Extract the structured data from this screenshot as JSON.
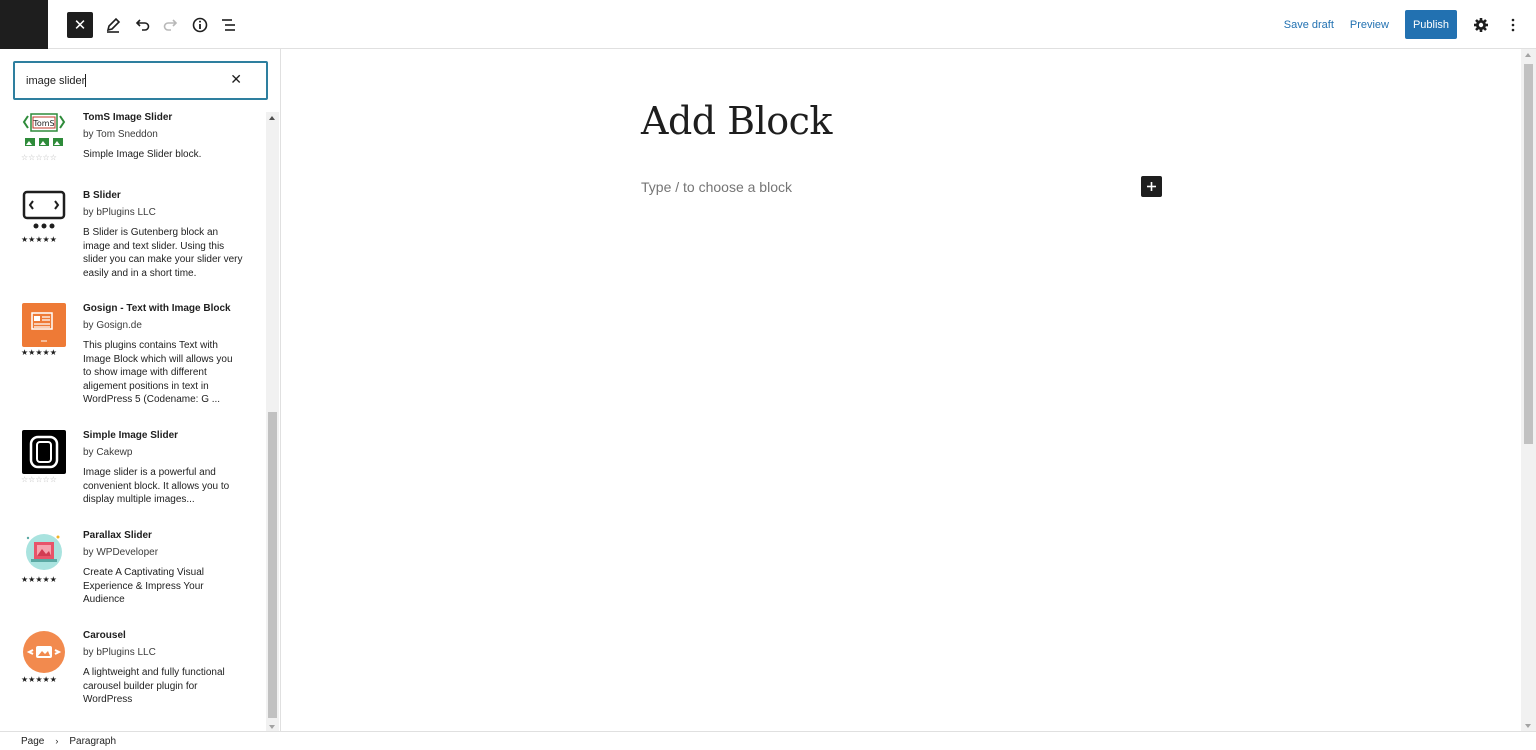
{
  "toolbar": {
    "close_label": "✕",
    "save_draft": "Save draft",
    "preview": "Preview",
    "publish": "Publish"
  },
  "search": {
    "value": "image slider"
  },
  "results": [
    {
      "title": "TomS Image Slider",
      "author": "by Tom Sneddon",
      "description": "Simple Image Slider block.",
      "rating": 0,
      "icon": "toms-slider-icon"
    },
    {
      "title": "B Slider",
      "author": "by bPlugins LLC",
      "description": "B Slider is Gutenberg block an image and text slider. Using this slider you can make your slider very easily and in a short time.",
      "rating": 5,
      "icon": "b-slider-icon"
    },
    {
      "title": "Gosign - Text with Image Block",
      "author": "by Gosign.de",
      "description": "This plugins contains Text with Image Block which will allows you to show image with different aligement positions in text in WordPress 5 (Codename: G ...",
      "rating": 5,
      "icon": "gosign-icon"
    },
    {
      "title": "Simple Image Slider",
      "author": "by Cakewp",
      "description": "Image slider is a powerful and convenient block. It allows you to display multiple images...",
      "rating": 0,
      "icon": "simple-slider-icon"
    },
    {
      "title": "Parallax Slider",
      "author": "by WPDeveloper",
      "description": "Create A Captivating Visual Experience & Impress Your Audience",
      "rating": 5,
      "icon": "parallax-slider-icon"
    },
    {
      "title": "Carousel",
      "author": "by bPlugins LLC",
      "description": "A lightweight and fully functional carousel builder plugin for WordPress",
      "rating": 5,
      "icon": "carousel-icon"
    }
  ],
  "editor": {
    "title": "Add Block",
    "placeholder": "Type / to choose a block"
  },
  "breadcrumb": {
    "items": [
      "Page",
      "Paragraph"
    ]
  },
  "colors": {
    "accent": "#2271b1",
    "focus": "#2e7f9f",
    "dark": "#1e1e1e"
  }
}
